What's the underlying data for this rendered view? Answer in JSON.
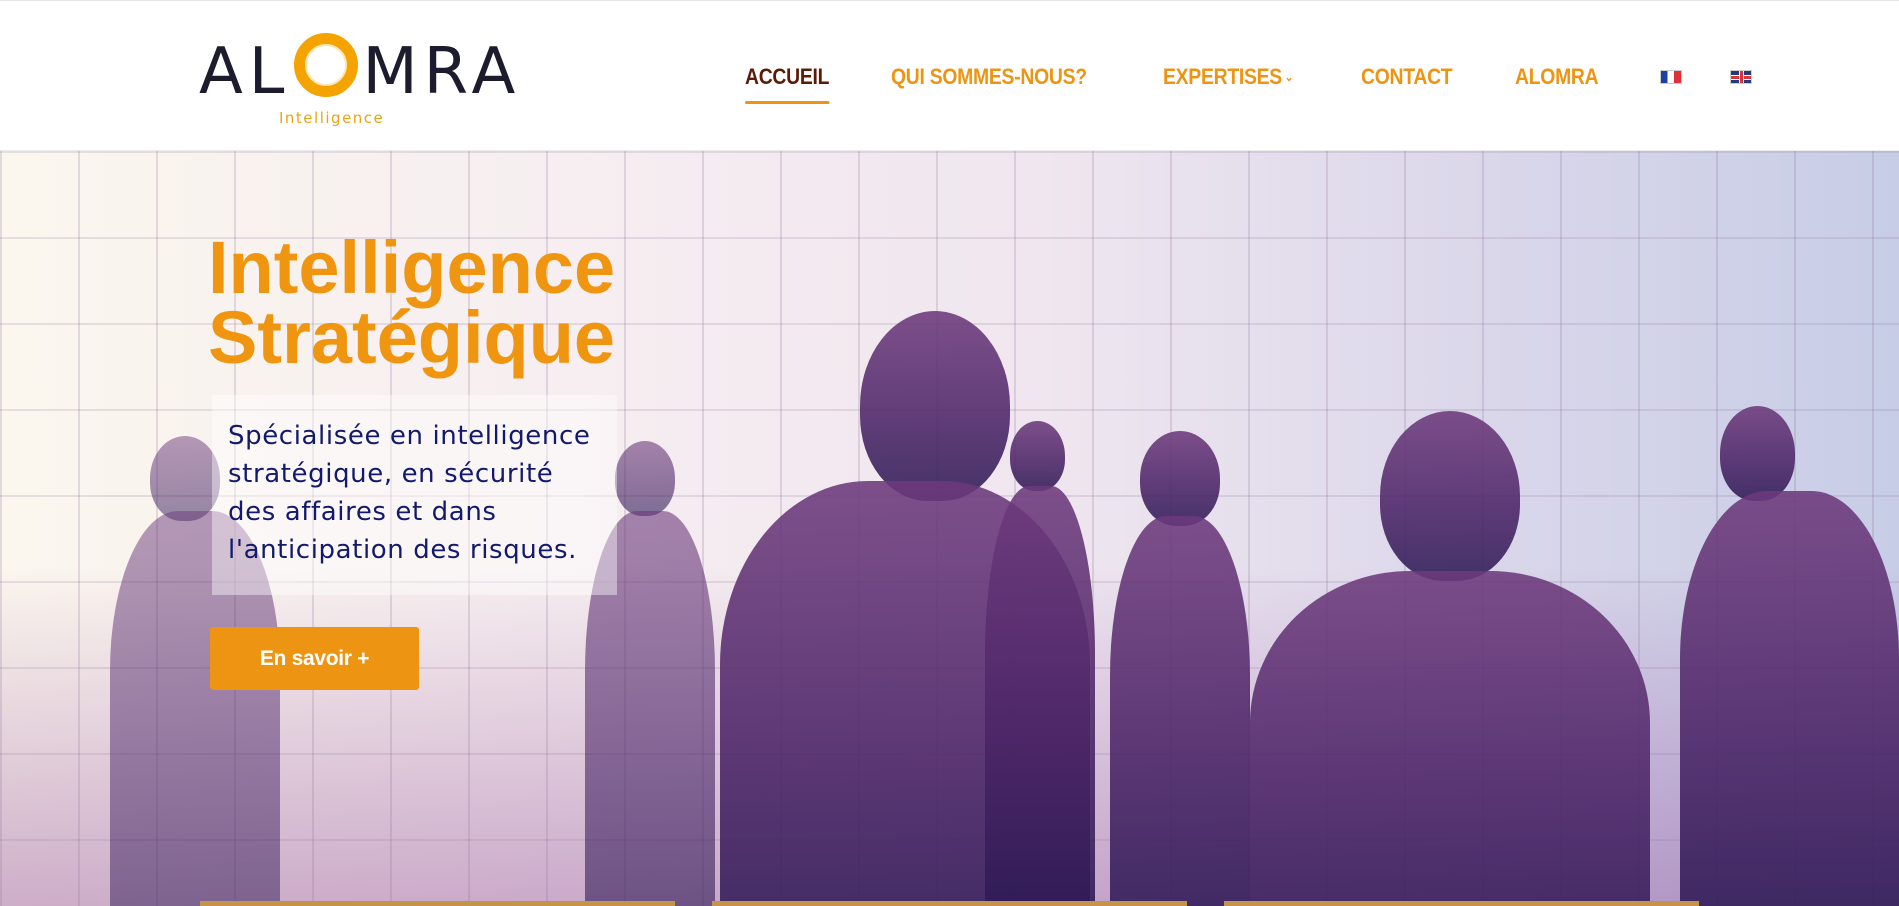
{
  "brand": {
    "logo_left": "AL",
    "logo_right": "MRA",
    "logo_sub": "Intelligence"
  },
  "nav": {
    "items": [
      {
        "label": "ACCUEIL",
        "active": true
      },
      {
        "label": "QUI SOMMES-NOUS?",
        "active": false
      },
      {
        "label": "EXPERTISES",
        "active": false,
        "has_dropdown": true
      },
      {
        "label": "CONTACT",
        "active": false
      },
      {
        "label": "ALOMRA",
        "active": false
      }
    ],
    "languages": [
      {
        "code": "fr",
        "icon": "flag-fr-icon"
      },
      {
        "code": "en",
        "icon": "flag-en-icon"
      }
    ],
    "dropdown_caret": "⌄"
  },
  "hero": {
    "title_line1": "Intelligence",
    "title_line2": "Stratégique",
    "description": "Spécialisée en intelligence stratégique, en sécurité des affaires et dans l'anticipation des risques.",
    "cta_label": "En savoir +"
  },
  "colors": {
    "accent": "#ee9413",
    "active_nav": "#5b1c05",
    "description_text": "#141a6b"
  }
}
